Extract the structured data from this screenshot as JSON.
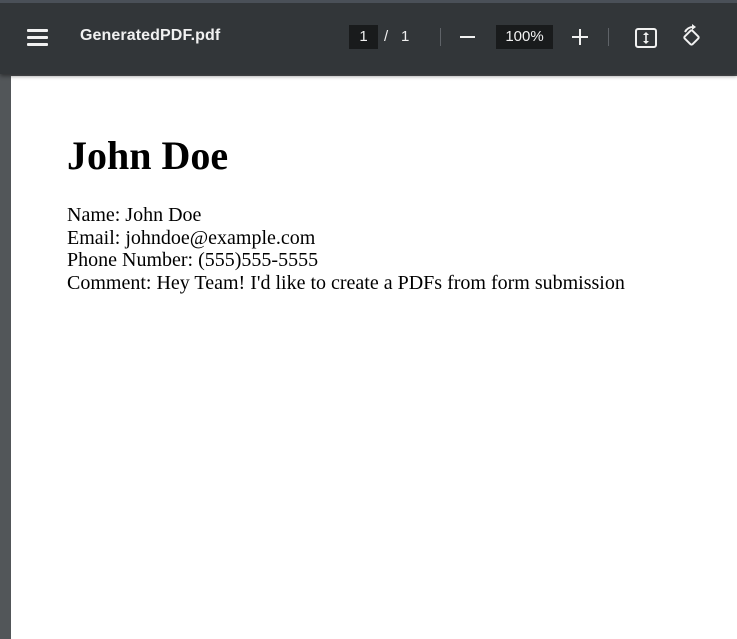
{
  "toolbar": {
    "title": "GeneratedPDF.pdf",
    "page_current": "1",
    "page_separator": "/",
    "page_total": "1",
    "zoom_level": "100%"
  },
  "icons": {
    "menu": "hamburger-menu-icon",
    "zoom_out": "minus-icon",
    "zoom_in": "plus-icon",
    "fit": "fit-to-page-icon",
    "rotate": "rotate-counterclockwise-icon"
  },
  "document": {
    "heading": "John Doe",
    "lines": [
      "Name: John Doe",
      "Email: johndoe@example.com",
      "Phone Number: (555)555-5555",
      "Comment: Hey Team! I'd like to create a PDFs from form submission"
    ]
  },
  "colors": {
    "toolbar_bg": "#323639",
    "viewer_bg": "#525659",
    "page_bg": "#ffffff",
    "input_bg": "#191b1c",
    "toolbar_text": "#f1f1f1"
  }
}
